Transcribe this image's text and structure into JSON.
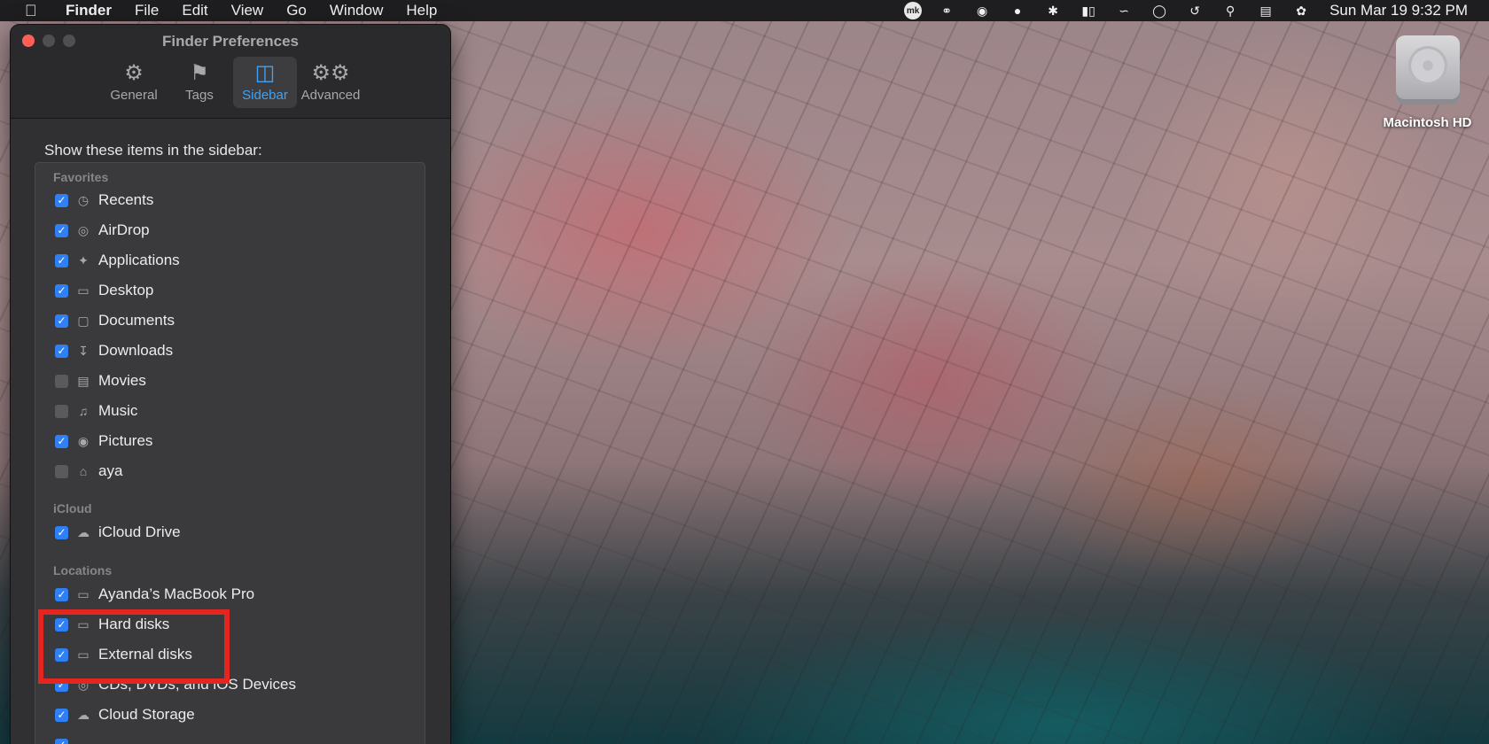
{
  "menubar": {
    "apple_icon": "apple-logo-icon",
    "app_name": "Finder",
    "menus": [
      "File",
      "Edit",
      "View",
      "Go",
      "Window",
      "Help"
    ],
    "status_icons": [
      "mk-badge-icon",
      "creative-cloud-icon",
      "grammarly-icon",
      "grammarly-g-icon",
      "bluetooth-icon",
      "battery-icon",
      "wifi-icon",
      "user-icon",
      "time-machine-icon",
      "spotlight-icon",
      "control-center-icon",
      "siri-icon"
    ],
    "mk_badge_text": "mk",
    "clock": "Sun Mar 19  9:32 PM"
  },
  "desktop": {
    "disk_label": "Macintosh HD"
  },
  "window": {
    "title": "Finder Preferences",
    "tabs": [
      {
        "label": "General",
        "icon": "gear-icon"
      },
      {
        "label": "Tags",
        "icon": "tag-icon"
      },
      {
        "label": "Sidebar",
        "icon": "sidebar-icon"
      },
      {
        "label": "Advanced",
        "icon": "gears-icon"
      }
    ],
    "active_tab": "Sidebar",
    "heading": "Show these items in the sidebar:",
    "sections": {
      "favorites": "Favorites",
      "icloud": "iCloud",
      "locations": "Locations"
    },
    "items": [
      {
        "label": "Recents",
        "checked": true,
        "icon": "clock-icon"
      },
      {
        "label": "AirDrop",
        "checked": true,
        "icon": "airdrop-icon"
      },
      {
        "label": "Applications",
        "checked": true,
        "icon": "applications-icon"
      },
      {
        "label": "Desktop",
        "checked": true,
        "icon": "desktop-icon"
      },
      {
        "label": "Documents",
        "checked": true,
        "icon": "document-icon"
      },
      {
        "label": "Downloads",
        "checked": true,
        "icon": "download-icon"
      },
      {
        "label": "Movies",
        "checked": false,
        "icon": "film-icon"
      },
      {
        "label": "Music",
        "checked": false,
        "icon": "music-note-icon"
      },
      {
        "label": "Pictures",
        "checked": true,
        "icon": "camera-icon"
      },
      {
        "label": "aya",
        "checked": false,
        "icon": "home-icon"
      },
      {
        "label": "iCloud Drive",
        "checked": true,
        "icon": "cloud-icon"
      },
      {
        "label": "Ayanda’s MacBook Pro",
        "checked": true,
        "icon": "laptop-icon"
      },
      {
        "label": "Hard disks",
        "checked": true,
        "icon": "hard-disk-icon"
      },
      {
        "label": "External disks",
        "checked": true,
        "icon": "external-disk-icon"
      },
      {
        "label": "CDs, DVDs, and iOS Devices",
        "checked": true,
        "icon": "disc-icon"
      },
      {
        "label": "Cloud Storage",
        "checked": true,
        "icon": "cloud-icon"
      }
    ]
  },
  "annotation": {
    "highlight_color": "#e3261f"
  }
}
